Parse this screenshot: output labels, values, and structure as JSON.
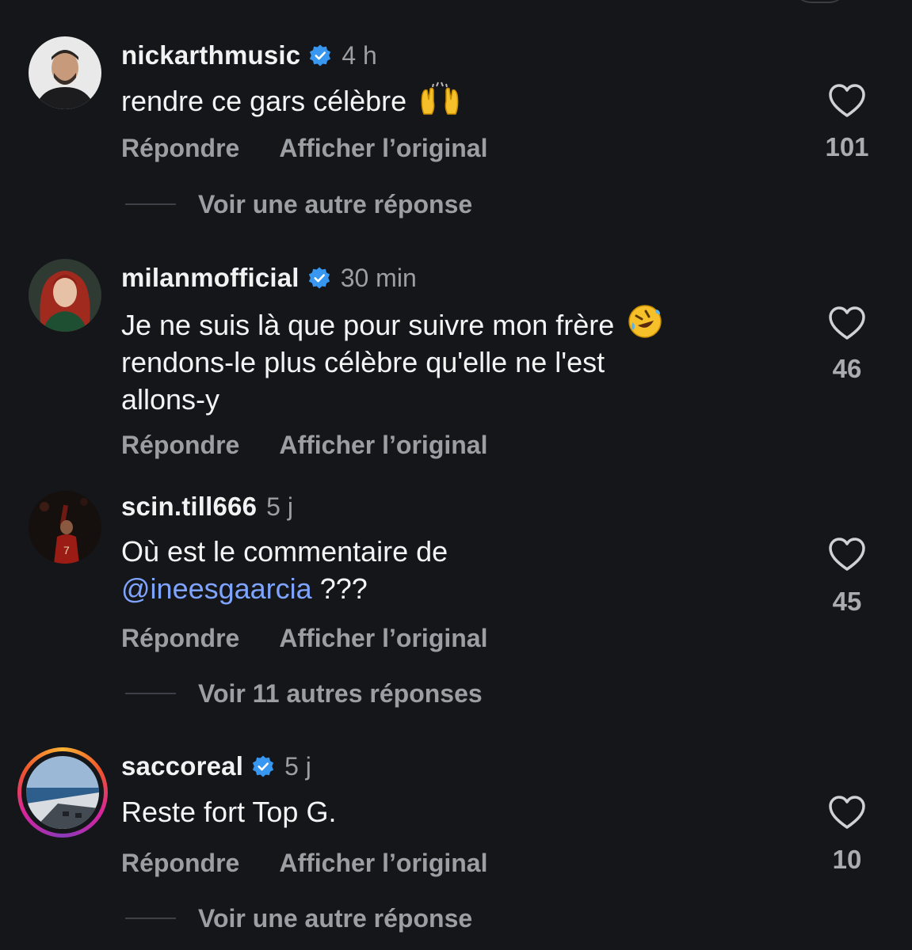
{
  "comments": [
    {
      "username": "nickarthmusic",
      "verified": true,
      "time": "4 h",
      "text": "rendre ce gars célèbre",
      "emoji": "raising-hands",
      "reply_label": "Répondre",
      "translate_label": "Afficher l’original",
      "likes": "101",
      "more_replies": "Voir une autre réponse"
    },
    {
      "username": "milanmofficial",
      "verified": true,
      "time": "30 min",
      "text_line1": "Je ne suis là que pour suivre mon frère",
      "emoji": "rolling-laughing",
      "text_line2": "rendons-le plus célèbre qu'elle ne l'est",
      "text_line3": "allons-y",
      "reply_label": "Répondre",
      "translate_label": "Afficher l’original",
      "likes": "46"
    },
    {
      "username": "scin.till666",
      "verified": false,
      "time": "5 j",
      "text_line1": "Où est le commentaire de",
      "mention": "@ineesgaarcia",
      "text_after_mention": " ???",
      "reply_label": "Répondre",
      "translate_label": "Afficher l’original",
      "likes": "45",
      "more_replies": "Voir 11 autres réponses"
    },
    {
      "username": "saccoreal",
      "verified": true,
      "time": "5 j",
      "text": "Reste fort Top G.",
      "reply_label": "Répondre",
      "translate_label": "Afficher l’original",
      "likes": "10",
      "more_replies": "Voir une autre réponse"
    }
  ],
  "colors": {
    "background": "#14161a",
    "text": "#f4f4f4",
    "muted": "#9b9ea3",
    "verified": "#3897f0",
    "mention": "#7fa4ff"
  }
}
